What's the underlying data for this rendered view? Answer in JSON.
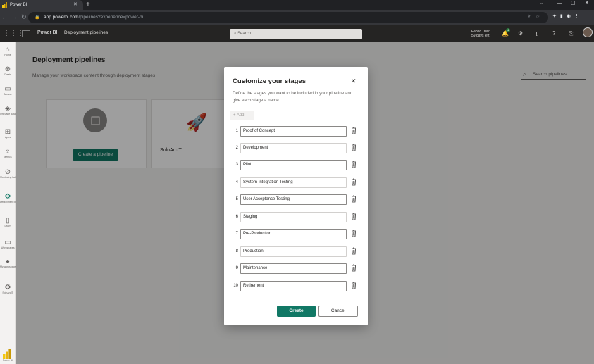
{
  "browser": {
    "tab_title": "Power BI",
    "url_host": "app.powerbi.com",
    "url_path": "/pipelines?experience=power-bi"
  },
  "header": {
    "app_name": "Power BI",
    "breadcrumb": "Deployment pipelines",
    "search_placeholder": "Search",
    "trial_line1": "Fabric Trial:",
    "trial_line2": "59 days left",
    "notification_count": "4"
  },
  "rail": {
    "items": [
      {
        "label": "Home",
        "icon": "⌂"
      },
      {
        "label": "Create",
        "icon": "⊕"
      },
      {
        "label": "Browse",
        "icon": "▭"
      },
      {
        "label": "OneLake data hub",
        "icon": "◈"
      },
      {
        "label": "Apps",
        "icon": "⊞"
      },
      {
        "label": "Metrics",
        "icon": "♆"
      },
      {
        "label": "Monitoring hub",
        "icon": "⊘"
      },
      {
        "label": "Deployment pipelines",
        "icon": "⚙"
      },
      {
        "label": "Learn",
        "icon": "▯"
      },
      {
        "label": "Workspaces",
        "icon": "▭"
      },
      {
        "label": "My workspace",
        "icon": "●"
      },
      {
        "label": "SolnArcIT",
        "icon": "⚙"
      }
    ],
    "footer_label": "Power BI"
  },
  "main": {
    "title": "Deployment pipelines",
    "subtitle": "Manage your workspace content through deployment stages",
    "search_placeholder": "Search pipelines",
    "create_button": "Create a pipeline",
    "pipeline_name": "SolnArcIT"
  },
  "dialog": {
    "title": "Customize your stages",
    "description": "Define the stages you want to be included in your pipeline and give each stage a name.",
    "add_label": "+ Add",
    "stages": [
      {
        "num": "1",
        "name": "Proof of Concept"
      },
      {
        "num": "2",
        "name": "Development"
      },
      {
        "num": "3",
        "name": "Pilot"
      },
      {
        "num": "4",
        "name": "System Integration Testing"
      },
      {
        "num": "5",
        "name": "User Acceptance Testing"
      },
      {
        "num": "6",
        "name": "Staging"
      },
      {
        "num": "7",
        "name": "Pre-Production"
      },
      {
        "num": "8",
        "name": "Production"
      },
      {
        "num": "9",
        "name": "Maintenance"
      },
      {
        "num": "10",
        "name": "Retirement"
      }
    ],
    "create_label": "Create",
    "cancel_label": "Cancel"
  },
  "colors": {
    "accent": "#117865",
    "header_bg": "#252423"
  }
}
